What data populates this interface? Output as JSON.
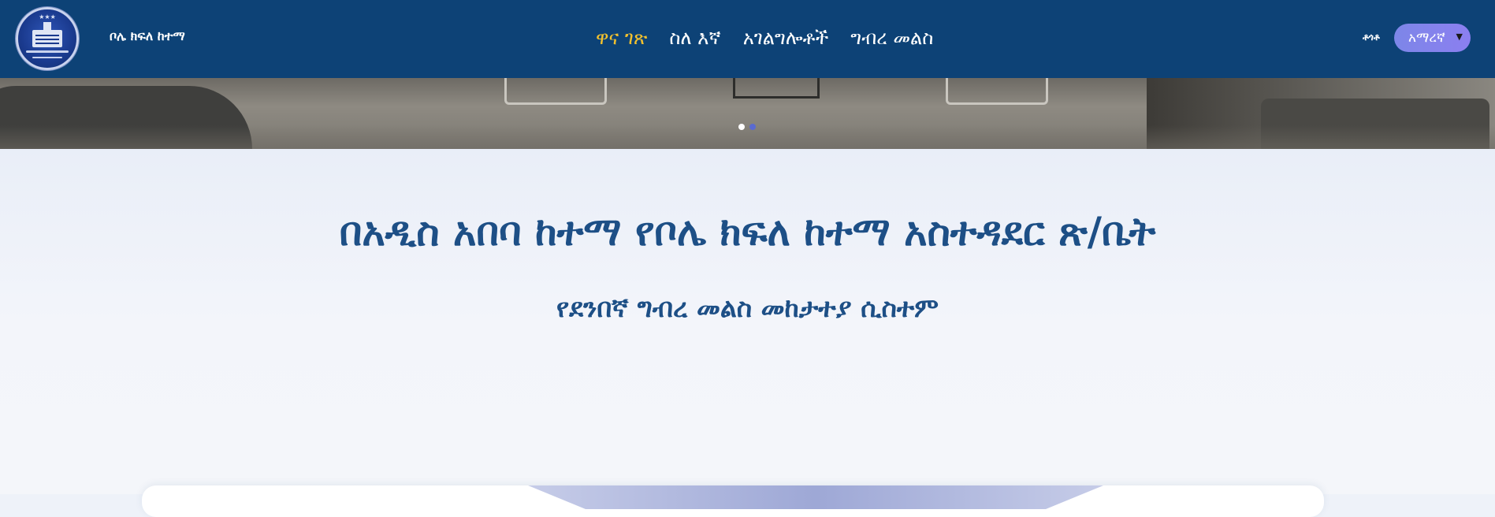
{
  "header": {
    "site_name": "ቦሌ ክፍለ ከተማ",
    "nav": [
      {
        "label": "ዋና ገጽ",
        "active": true
      },
      {
        "label": "ስለ እኛ",
        "active": false
      },
      {
        "label": "አገልግሎቶች",
        "active": false
      },
      {
        "label": "ግብረ መልስ",
        "active": false
      }
    ],
    "search_label": "ቶጎቶ",
    "language": {
      "selected": "አማረኛ"
    }
  },
  "hero": {
    "slides": 2,
    "active_slide": 1
  },
  "main": {
    "title": "በአዲስ አበባ ከተማ የቦሌ ክፍለ ከተማ አስተዳደር ጽ/ቤት",
    "subtitle": "የደንበኛ ግብረ መልስ መከታተያ ሲስተም"
  },
  "colors": {
    "navbar": "#0d4276",
    "active_nav": "#f2c12e",
    "title": "#1d4f86",
    "lang_button": "#8b7ff0"
  }
}
